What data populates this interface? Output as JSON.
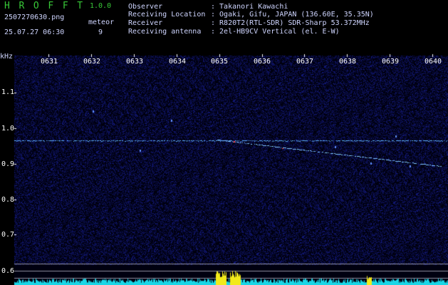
{
  "header": {
    "app_title": "H R O F F T",
    "version": "1.0.0",
    "filename": "2507270630.png",
    "datetime": "25.07.27 06:30",
    "meteor_label": "meteor",
    "meteor_count": "9"
  },
  "info": [
    {
      "key": "Observer",
      "value": ": Takanori Kawachi"
    },
    {
      "key": "Receiving Location",
      "value": ": Ogaki, Gifu, JAPAN (136.60E, 35.35N)"
    },
    {
      "key": "Receiver",
      "value": ": R820T2(RTL-SDR) SDR-Sharp 53.372MHz"
    },
    {
      "key": "Receiving antenna",
      "value": ": 2el-HB9CV Vertical (el. E-W)"
    }
  ],
  "axes": {
    "y_unit": "kHz",
    "x_ticks": [
      "0631",
      "0632",
      "0633",
      "0634",
      "0635",
      "0636",
      "0637",
      "0638",
      "0639",
      "0640"
    ],
    "y_ticks": [
      "1.1",
      "1.0",
      "0.9",
      "0.8",
      "0.7",
      "0.6"
    ]
  },
  "colors": {
    "background": "#000010",
    "text": "#cfd5ff",
    "title": "#38c838",
    "carrier": "#5fb0ff",
    "spectrum_fill": "#19d6e6",
    "spectrum_peak": "#f2ea1a"
  }
}
